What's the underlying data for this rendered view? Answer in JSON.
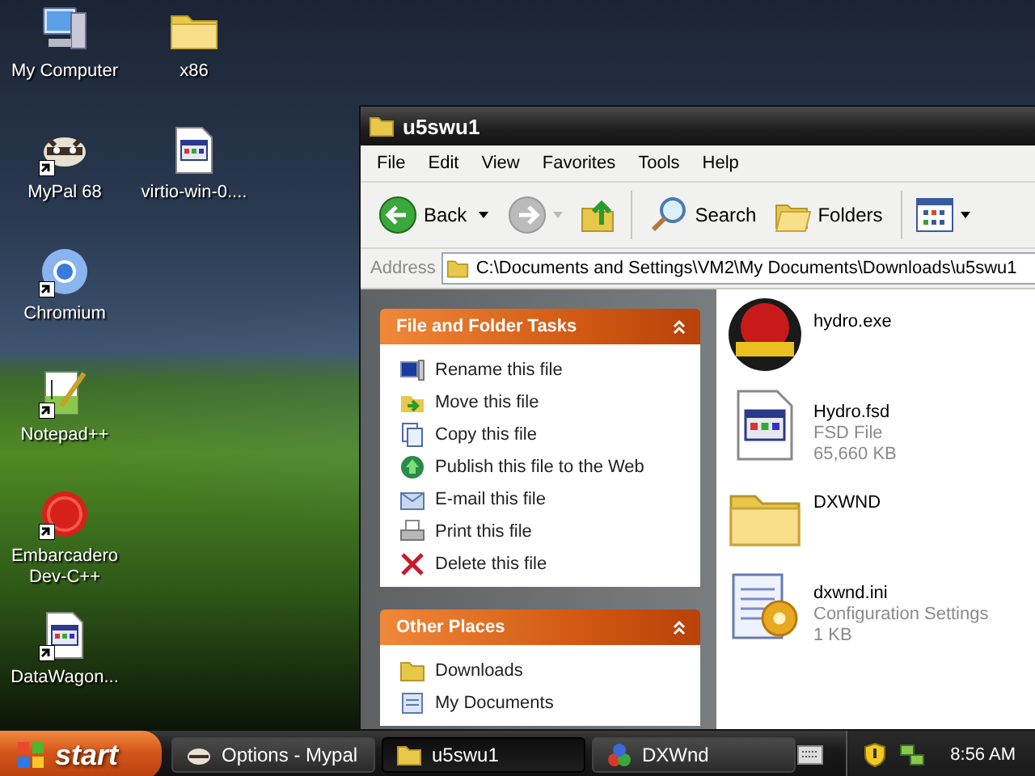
{
  "desktop_icons": [
    {
      "label": "My Computer",
      "kind": "computer",
      "shortcut": false
    },
    {
      "label": "MyPal 68",
      "kind": "mypal",
      "shortcut": true
    },
    {
      "label": "Chromium",
      "kind": "chromium",
      "shortcut": true
    },
    {
      "label": "Notepad++",
      "kind": "notepad",
      "shortcut": true
    },
    {
      "label": "Embarcadero Dev-C++",
      "kind": "devcpp",
      "shortcut": true
    },
    {
      "label": "DataWagon...",
      "kind": "program",
      "shortcut": true
    },
    {
      "label": "x86",
      "kind": "folder",
      "shortcut": false
    },
    {
      "label": "virtio-win-0....",
      "kind": "program",
      "shortcut": false
    }
  ],
  "window": {
    "title": "u5swu1",
    "menu": [
      "File",
      "Edit",
      "View",
      "Favorites",
      "Tools",
      "Help"
    ],
    "toolbar": {
      "back": "Back",
      "search": "Search",
      "folders": "Folders"
    },
    "address": {
      "label": "Address",
      "value": "C:\\Documents and Settings\\VM2\\My Documents\\Downloads\\u5swu1"
    },
    "task_panels": [
      {
        "title": "File and Folder Tasks",
        "items": [
          {
            "label": "Rename this file",
            "kind": "rename"
          },
          {
            "label": "Move this file",
            "kind": "move"
          },
          {
            "label": "Copy this file",
            "kind": "copy"
          },
          {
            "label": "Publish this file to the Web",
            "kind": "publish"
          },
          {
            "label": "E-mail this file",
            "kind": "email"
          },
          {
            "label": "Print this file",
            "kind": "print"
          },
          {
            "label": "Delete this file",
            "kind": "delete"
          }
        ]
      },
      {
        "title": "Other Places",
        "items": [
          {
            "label": "Downloads",
            "kind": "folder"
          },
          {
            "label": "My Documents",
            "kind": "documents"
          }
        ]
      }
    ],
    "files": [
      {
        "name": "hydro.exe",
        "kind": "game"
      },
      {
        "name": "Hydro.fsd",
        "type": "FSD File",
        "size": "65,660 KB",
        "kind": "program"
      },
      {
        "name": "DXWND",
        "kind": "folder"
      },
      {
        "name": "dxwnd.ini",
        "type": "Configuration Settings",
        "size": "1 KB",
        "kind": "ini"
      }
    ]
  },
  "taskbar": {
    "start": "start",
    "buttons": [
      {
        "label": "Options - Mypal",
        "kind": "mypal",
        "selected": false
      },
      {
        "label": "u5swu1",
        "kind": "folder",
        "selected": true
      },
      {
        "label": "DXWnd",
        "kind": "dxwnd",
        "selected": false
      }
    ],
    "clock": "8:56 AM"
  }
}
